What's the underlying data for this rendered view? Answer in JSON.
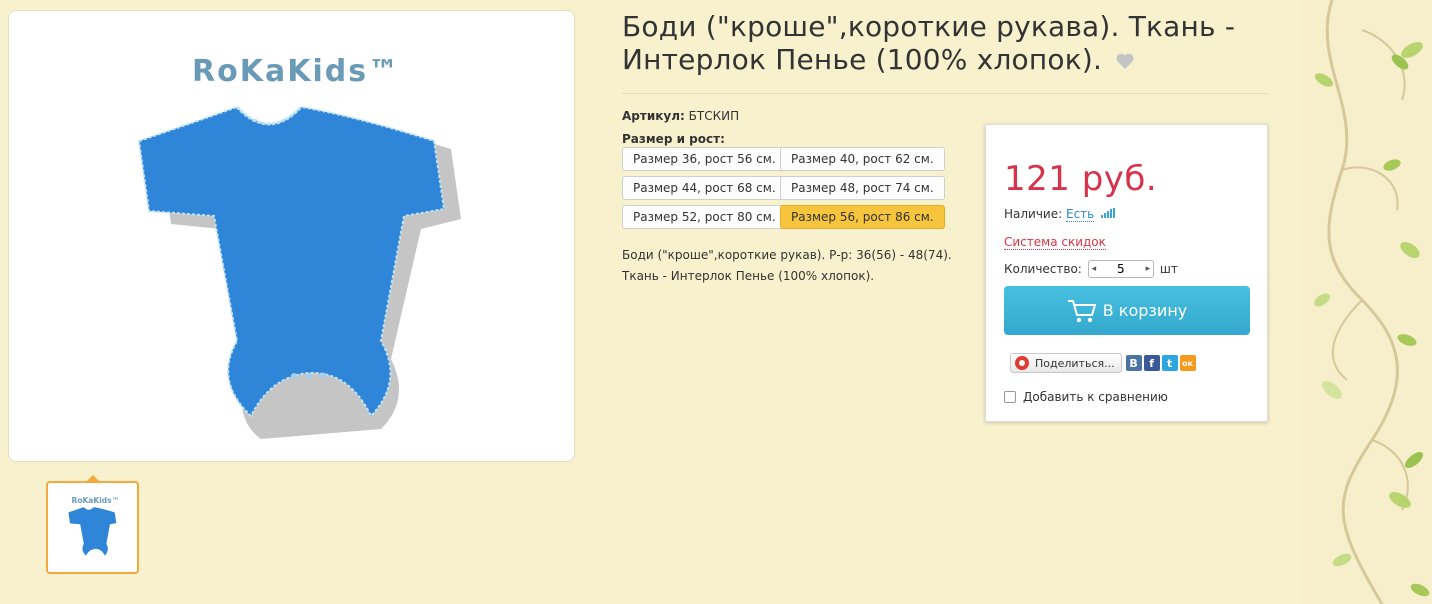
{
  "product": {
    "title": "Боди (\"кроше\",короткие рукава). Ткань - Интерлок Пенье (100% хлопок).",
    "brand_logo_text": "RoKaKids™",
    "article_label": "Артикул:",
    "article_value": "БТСКИП",
    "size_label": "Размер и рост:",
    "sizes": [
      {
        "label": "Размер 36, рост 56 см.",
        "active": false
      },
      {
        "label": "Размер 40, рост 62 см.",
        "active": false
      },
      {
        "label": "Размер 44, рост 68 см.",
        "active": false
      },
      {
        "label": "Размер 48, рост 74 см.",
        "active": false
      },
      {
        "label": "Размер 52, рост 80 см.",
        "active": false
      },
      {
        "label": "Размер 56, рост 86 см.",
        "active": true
      }
    ],
    "description_line1": "Боди (\"кроше\",короткие рукав). Р-р: 36(56) - 48(74).",
    "description_line2": "Ткань - Интерлок Пенье (100% хлопок)."
  },
  "buybox": {
    "price": "121 руб.",
    "availability_label": "Наличие:",
    "availability_value": "Есть",
    "discount_link": "Система скидок",
    "quantity_label": "Количество:",
    "quantity_value": "5",
    "quantity_unit": "шт",
    "cart_button": "В корзину",
    "share_button": "Поделиться...",
    "social": [
      {
        "name": "vk",
        "glyph": "В",
        "color": "#4c75a3"
      },
      {
        "name": "facebook",
        "glyph": "f",
        "color": "#3b5998"
      },
      {
        "name": "twitter",
        "glyph": "t",
        "color": "#2ea7e0"
      },
      {
        "name": "odnoklassniki",
        "glyph": "ок",
        "color": "#f49a1c"
      }
    ],
    "compare_label": "Добавить к сравнению"
  },
  "colors": {
    "price": "#d8334a",
    "cart_button": "#3db3d6",
    "active_size": "#f6c43d",
    "link": "#2b8ac6"
  }
}
